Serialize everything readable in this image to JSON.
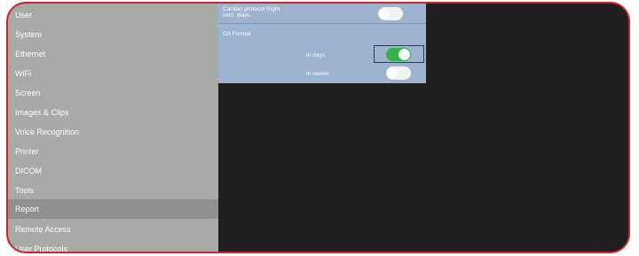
{
  "sidebar": {
    "items": [
      {
        "label": "User"
      },
      {
        "label": "System"
      },
      {
        "label": "Ethernet"
      },
      {
        "label": "WiFi"
      },
      {
        "label": "Screen"
      },
      {
        "label": "Images & Clips"
      },
      {
        "label": "Voice Recognition"
      },
      {
        "label": "Printer"
      },
      {
        "label": "DICOM"
      },
      {
        "label": "Tools"
      },
      {
        "label": "Report",
        "active": true
      },
      {
        "label": "Remote Access"
      },
      {
        "label": "User Protocols"
      }
    ]
  },
  "report_panel": {
    "cardiac_label_line1": "Cardiac protocol Right",
    "cardiac_label_line2": "vent. diam.",
    "cardiac_toggle": false,
    "ga_format_label": "GA Format",
    "in_days_label": "In days",
    "in_days_toggle": true,
    "in_weeks_label": "In weeks",
    "in_weeks_toggle": false
  },
  "colors": {
    "frame_border": "#d8222a",
    "sidebar_bg": "#a5aba6",
    "sidebar_active": "#8c938e",
    "panel_bg": "#9db3cf",
    "toggle_on": "#33b34a",
    "content_bg": "#1f1f1f"
  }
}
